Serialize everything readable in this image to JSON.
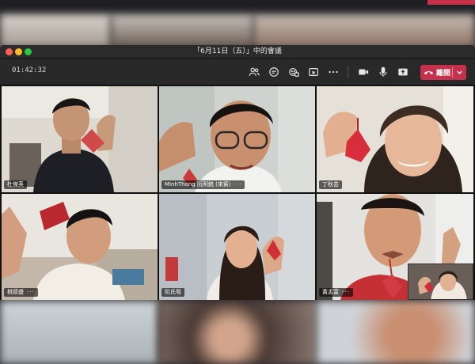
{
  "window": {
    "title": "「6月11日（五）」中的會議"
  },
  "toolbar": {
    "timer": "01:42:32",
    "leave_label": "離開",
    "icons": [
      "participants-icon",
      "chat-icon",
      "reactions-icon",
      "rooms-icon",
      "more-icon",
      "camera-icon",
      "mic-icon",
      "share-icon"
    ]
  },
  "participants": [
    {
      "name": "杜傑英",
      "more": false
    },
    {
      "name": "MinhThong 阮明統 (來賓)",
      "more": true
    },
    {
      "name": "丁秋芸",
      "more": false
    },
    {
      "name": "桃德盛",
      "more": true
    },
    {
      "name": "阮氏萄",
      "more": false
    },
    {
      "name": "黃孟富",
      "more": true
    }
  ],
  "colors": {
    "accent": "#7f85f5",
    "leave": "#c4314b",
    "window_bg": "#1f1f1f",
    "toolbar_bg": "#292929"
  }
}
